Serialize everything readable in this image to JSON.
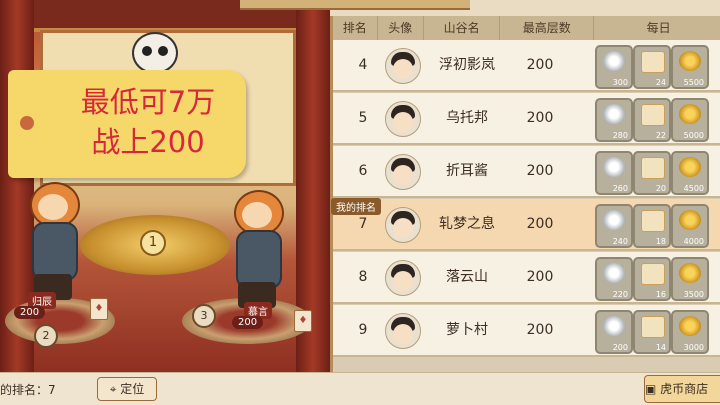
{
  "promo": {
    "line1": "最低可7万",
    "line2": "战上200"
  },
  "leaderboard": {
    "headers": [
      "排名",
      "头像",
      "山谷名",
      "最高层数",
      "每日"
    ],
    "my_rank_label": "我的排名",
    "rows": [
      {
        "rank": "4",
        "name": "浮初影岚",
        "floor": "200",
        "rewards": [
          "300",
          "24",
          "5500"
        ]
      },
      {
        "rank": "5",
        "name": "乌托邦",
        "floor": "200",
        "rewards": [
          "280",
          "22",
          "5000"
        ]
      },
      {
        "rank": "6",
        "name": "折耳酱",
        "floor": "200",
        "rewards": [
          "260",
          "20",
          "4500"
        ]
      },
      {
        "rank": "7",
        "name": "轧梦之息",
        "floor": "200",
        "rewards": [
          "240",
          "18",
          "4000"
        ]
      },
      {
        "rank": "8",
        "name": "落云山",
        "floor": "200",
        "rewards": [
          "220",
          "16",
          "3500"
        ]
      },
      {
        "rank": "9",
        "name": "萝卜村",
        "floor": "200",
        "rewards": [
          "200",
          "14",
          "3000"
        ]
      }
    ]
  },
  "scene": {
    "player_left": {
      "name": "归辰",
      "score": "200",
      "rank": "2"
    },
    "player_right": {
      "name": "慕言",
      "score": "200",
      "rank": "3"
    },
    "podium_rank": "1"
  },
  "footer": {
    "my_rank_text": "的排名：7",
    "locate_label": "定位",
    "shop_label": "虎币商店"
  }
}
